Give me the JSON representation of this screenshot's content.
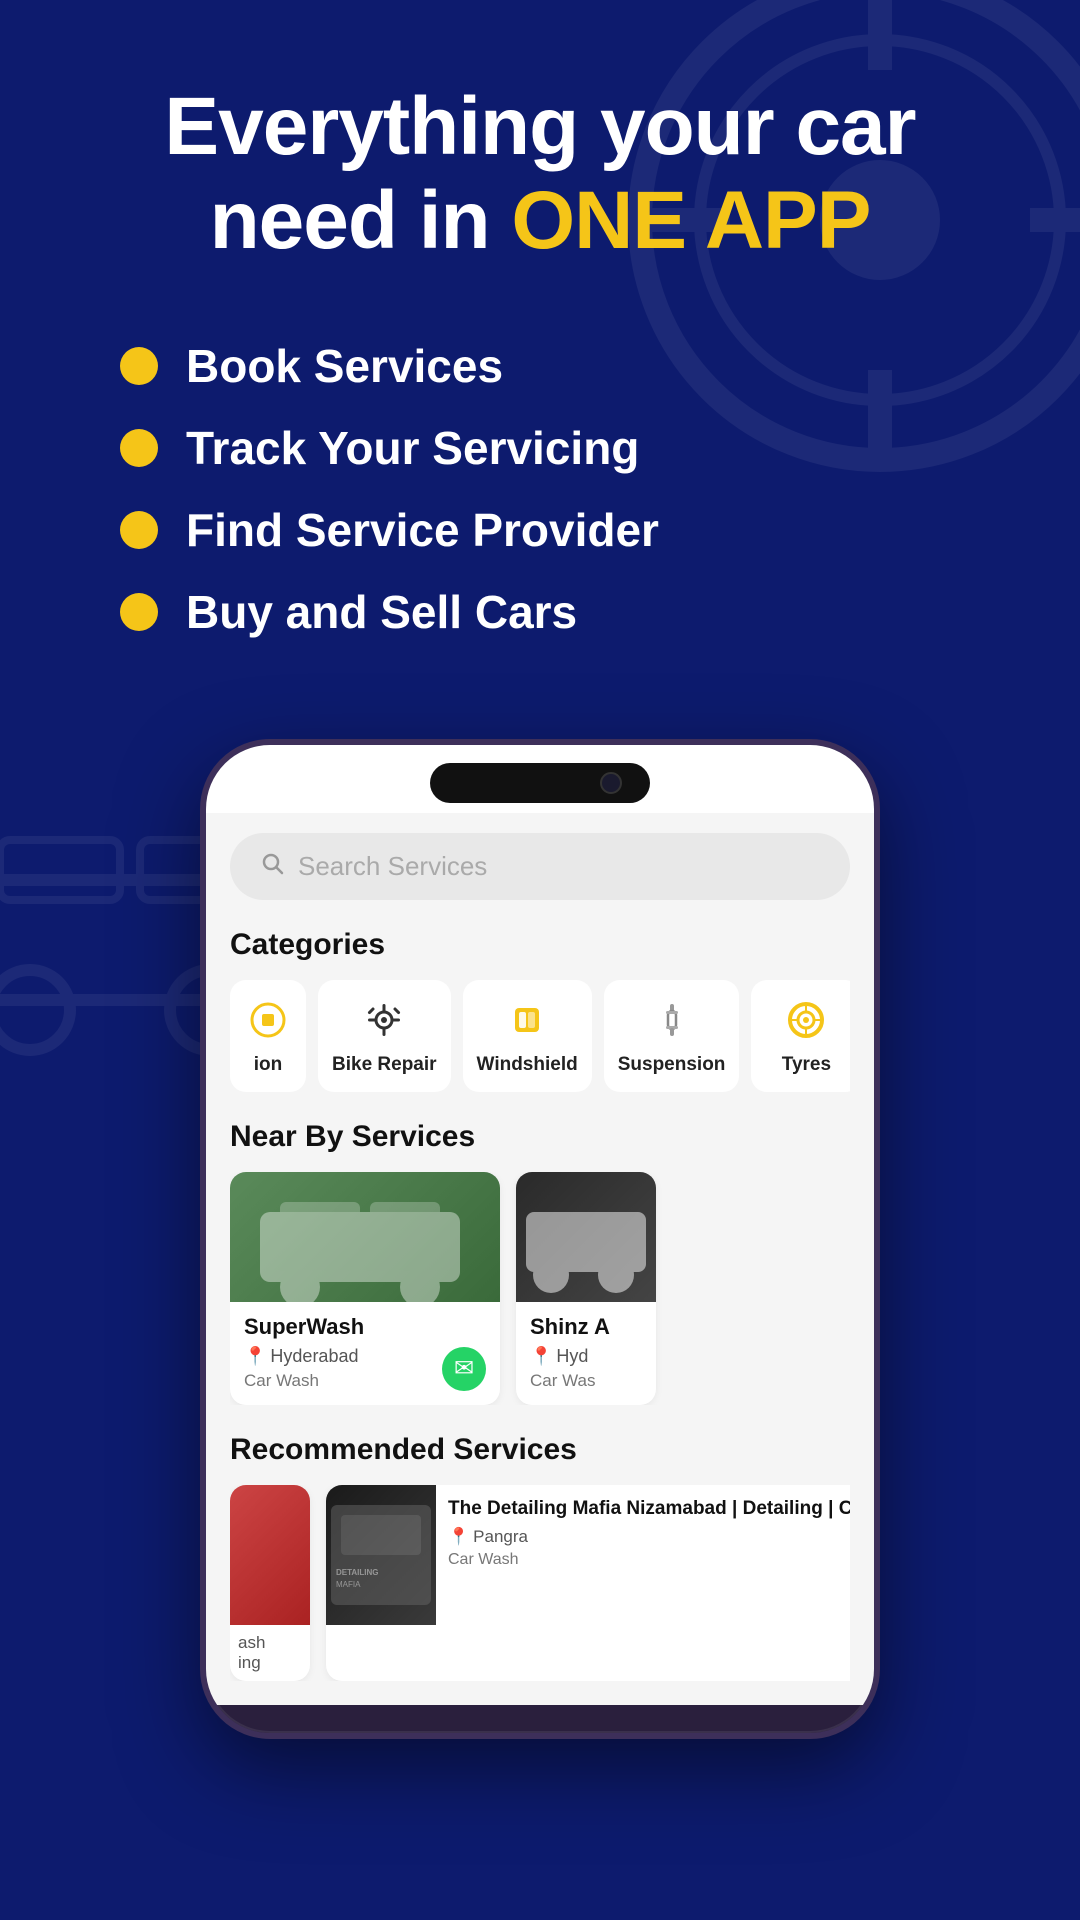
{
  "hero": {
    "title_part1": "Everything your car",
    "title_part2": "need in ",
    "title_highlight": "ONE APP"
  },
  "features": [
    {
      "id": "book",
      "label": "Book Services"
    },
    {
      "id": "track",
      "label": "Track Your Servicing"
    },
    {
      "id": "find",
      "label": "Find Service Provider"
    },
    {
      "id": "buy",
      "label": "Buy and Sell Cars"
    }
  ],
  "search": {
    "placeholder": "Search Services"
  },
  "categories": {
    "title": "Categories",
    "items": [
      {
        "id": "partial",
        "label": "ion",
        "icon": "partial"
      },
      {
        "id": "bike-repair",
        "label": "Bike Repair",
        "icon": "gear"
      },
      {
        "id": "windshield",
        "label": "Windshield",
        "icon": "windshield"
      },
      {
        "id": "suspension",
        "label": "Suspension",
        "icon": "suspension"
      },
      {
        "id": "tyres",
        "label": "Tyres",
        "icon": "tyre"
      }
    ]
  },
  "nearby": {
    "title": "Near By Services",
    "items": [
      {
        "id": "superwash",
        "name": "SuperWash",
        "location": "Hyderabad",
        "type": "Car Wash",
        "img": "wash"
      },
      {
        "id": "shinz",
        "name": "Shinz A",
        "location": "Hyd",
        "type": "Car Was",
        "img": "bmw",
        "partial": true
      }
    ]
  },
  "recommended": {
    "title": "Recommended Services",
    "items": [
      {
        "id": "partial-left",
        "name": "ash\ning",
        "partial_left": true
      },
      {
        "id": "detailing-mafia",
        "name": "The Detailing Mafia Nizamabad | Detailing | Ceramic Coating | Car PPF",
        "location": "Pangra",
        "type": "Car Wash",
        "img": "detailing"
      },
      {
        "id": "partial-right",
        "partial_right": true
      }
    ]
  },
  "colors": {
    "bg": "#0d1b6e",
    "accent": "#f5c518",
    "white": "#ffffff",
    "whatsapp": "#25d366"
  }
}
